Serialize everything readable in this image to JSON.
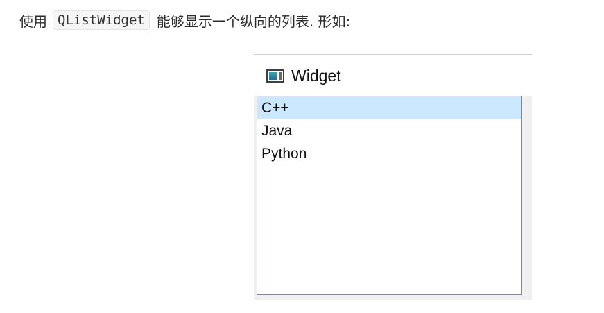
{
  "intro": {
    "prefix": "使用",
    "code": "QListWidget",
    "suffix": "能够显示一个纵向的列表. 形如:"
  },
  "window": {
    "title": "Widget",
    "icon": "qt-app-window-icon"
  },
  "list": {
    "items": [
      "C++",
      "Java",
      "Python"
    ],
    "selected_index": 0
  },
  "colors": {
    "selection": "#cce8ff",
    "window_bg": "#f0f0f0",
    "list_border": "#828790"
  }
}
